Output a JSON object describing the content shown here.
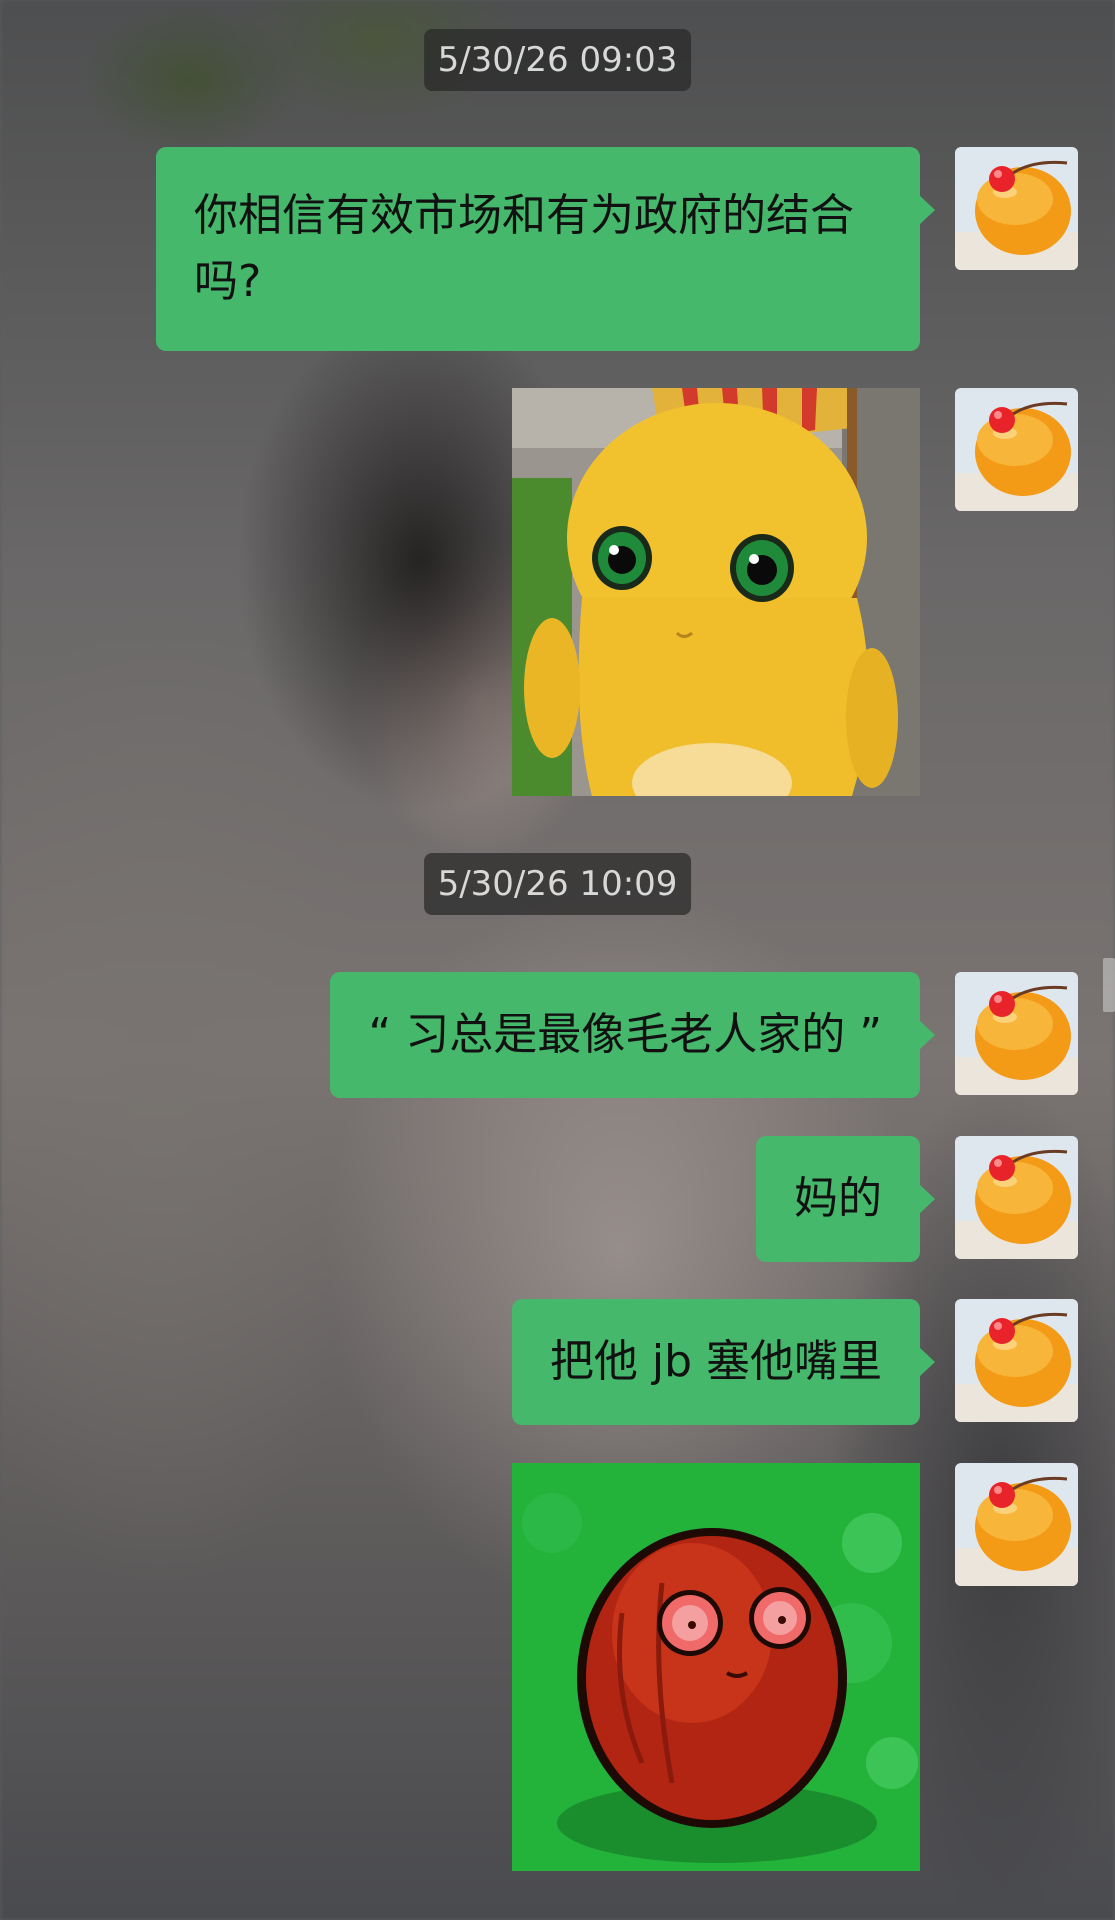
{
  "timestamps": [
    "5/30/26 09:03",
    "5/30/26 10:09"
  ],
  "messages": [
    {
      "type": "text",
      "text": "你相信有效市场和有为政府的结合吗?"
    },
    {
      "type": "image",
      "icon": "yellow-cartoon-creature-sticker"
    },
    {
      "type": "text",
      "text": "“ 习总是最像毛老人家的 ”"
    },
    {
      "type": "text",
      "text": "妈的"
    },
    {
      "type": "text",
      "text": "把他 jb 塞他嘴里"
    },
    {
      "type": "image",
      "icon": "red-wall-nut-sticker"
    }
  ],
  "avatar": {
    "icon": "mango-pudding-cherry-avatar"
  },
  "colors": {
    "bubble": "#45b86c",
    "timestamp_bg": "#2c2c2c",
    "timestamp_text": "#d8d8d8"
  }
}
